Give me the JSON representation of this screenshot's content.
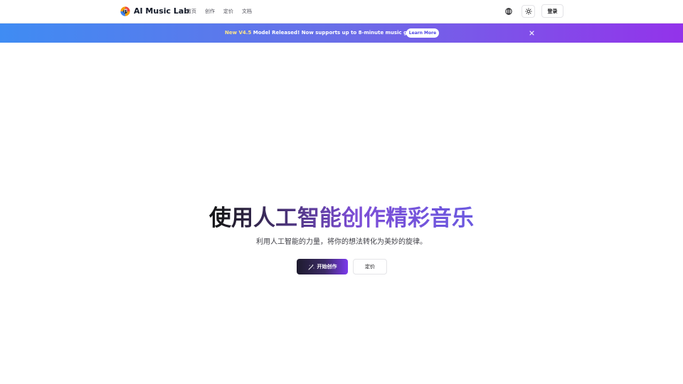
{
  "header": {
    "brand_name": "AI Music Lab",
    "nav": [
      {
        "label": "首页"
      },
      {
        "label": "创作"
      },
      {
        "label": "定价"
      },
      {
        "label": "文档"
      }
    ],
    "language_icon": "globe-icon",
    "theme_icon": "sun-icon",
    "login_label": "登录"
  },
  "banner": {
    "highlight": "New V4.5",
    "message": " Model Released! Now supports up to 8-minute music generation",
    "learn_more_label": "Learn More",
    "close_icon": "close-icon"
  },
  "hero": {
    "title": "使用人工智能创作精彩音乐",
    "subtitle": "利用人工智能的力量，将你的想法转化为美妙的旋律。",
    "primary_cta_label": "开始创作",
    "primary_cta_icon": "magic-wand-icon",
    "secondary_cta_label": "定价"
  },
  "colors": {
    "banner_start": "#3f8cf3",
    "banner_end": "#9333ea",
    "banner_highlight": "#fde68a",
    "title_gradient_end": "#4f6ff0"
  }
}
